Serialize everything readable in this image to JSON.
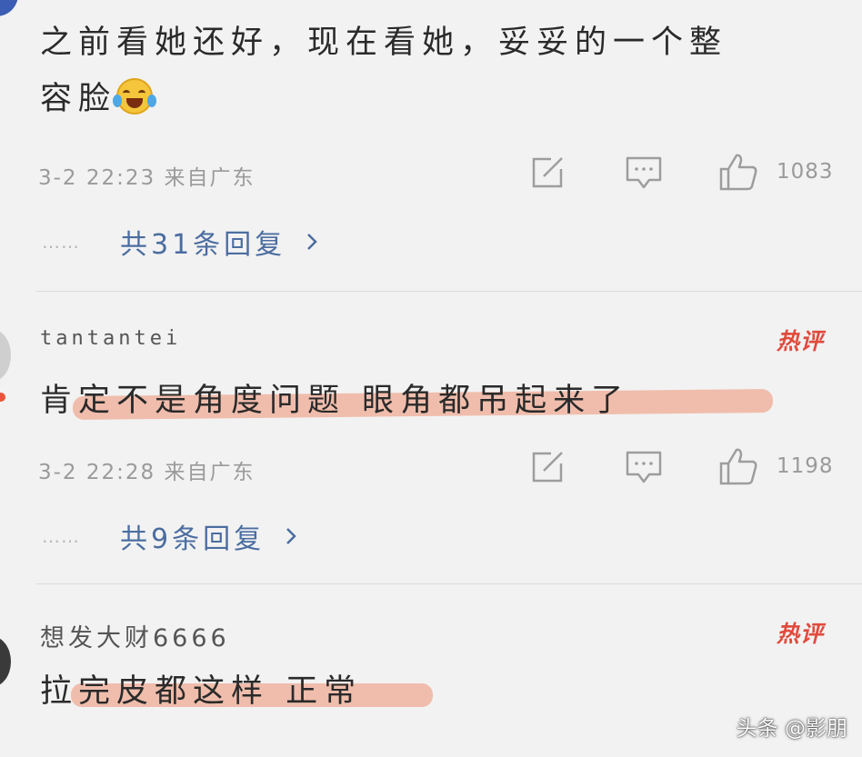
{
  "comments": [
    {
      "text_line1": "之前看她还好，现在看她，妥妥的一个整",
      "text_line2": "容脸",
      "emoji": "laugh-cry-emoji",
      "time": "3-2 22:23",
      "location": "来自广东",
      "likes": "1083",
      "replies": "共31条回复"
    },
    {
      "username": "tantantei",
      "badge": "热评",
      "text": "肯定不是角度问题 眼角都吊起来了",
      "time": "3-2 22:28",
      "location": "来自广东",
      "likes": "1198",
      "replies": "共9条回复"
    },
    {
      "username": "想发大财6666",
      "badge": "热评",
      "text": "拉完皮都这样 正常"
    }
  ],
  "icons": {
    "share": "share-edit-icon",
    "reply": "comment-bubble-icon",
    "like": "thumbs-up-icon",
    "more": "chevron-right-icon"
  },
  "colors": {
    "background": "#f2f2f2",
    "link": "#4b6da0",
    "hot_badge": "#e04a3c",
    "highlight": "#f0b7a4"
  },
  "watermark": "头条 @影朋",
  "reply_dots": "……"
}
